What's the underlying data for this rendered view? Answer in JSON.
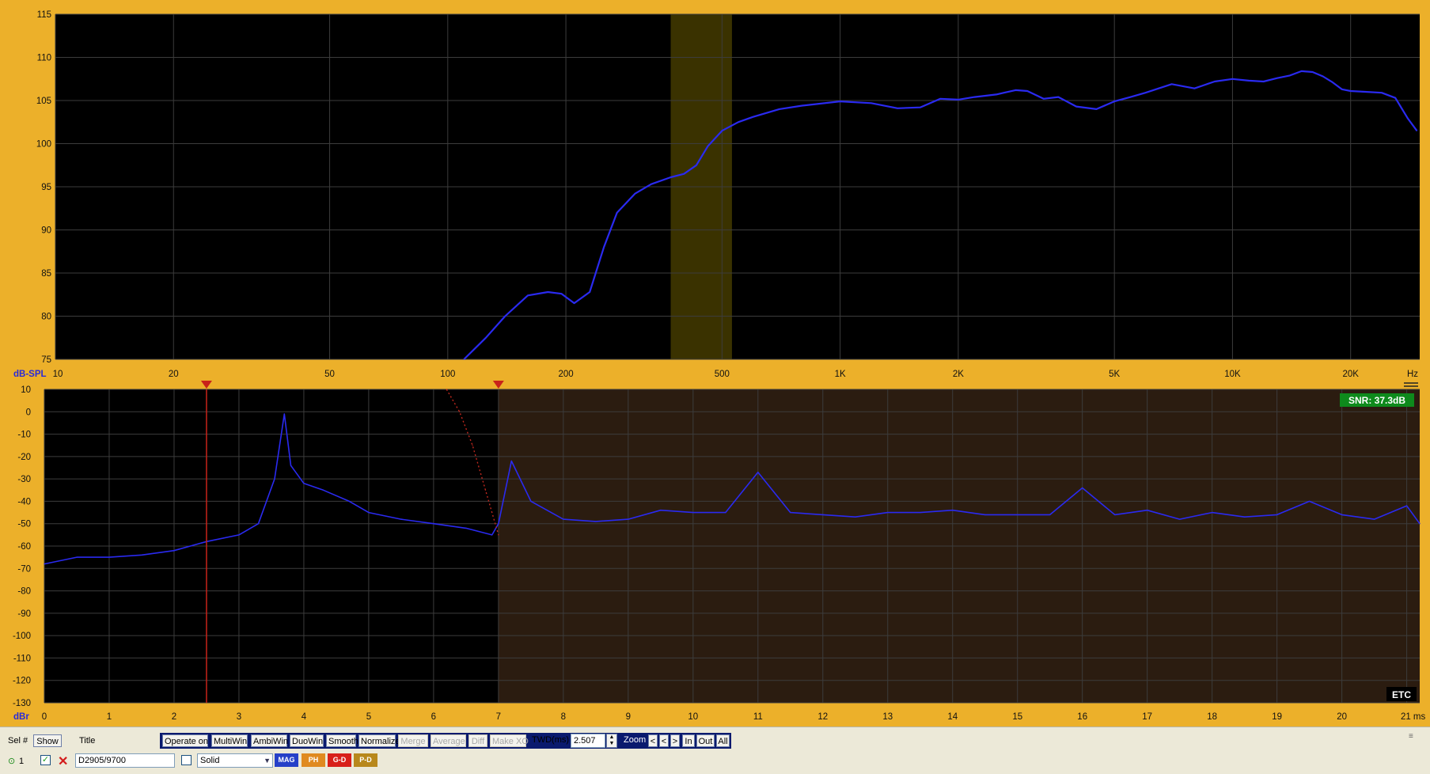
{
  "chart_data": [
    {
      "type": "line",
      "title": "",
      "xscale": "log",
      "xlim": [
        10,
        30000
      ],
      "ylim": [
        75,
        115
      ],
      "ylabel": "dB-SPL",
      "xunit": "Hz",
      "x_ticks": [
        10,
        20,
        50,
        100,
        200,
        500,
        1000,
        2000,
        5000,
        10000,
        20000
      ],
      "x_tick_labels": [
        "10",
        "20",
        "50",
        "100",
        "200",
        "500",
        "1K",
        "2K",
        "5K",
        "10K",
        "20K"
      ],
      "y_ticks": [
        75,
        80,
        85,
        90,
        95,
        100,
        105,
        110,
        115
      ],
      "y_tick_labels": [
        "75",
        "80",
        "85",
        "90",
        "95",
        "100",
        "105",
        "110",
        "115"
      ],
      "grid": true,
      "highlight_band_hz": [
        370,
        530
      ],
      "series": [
        {
          "color": "#2a2af0",
          "x": [
            110,
            125,
            140,
            160,
            180,
            195,
            210,
            230,
            250,
            270,
            300,
            330,
            370,
            400,
            430,
            460,
            500,
            550,
            600,
            700,
            800,
            1000,
            1200,
            1400,
            1600,
            1800,
            2000,
            2200,
            2500,
            2800,
            3000,
            3300,
            3600,
            4000,
            4500,
            5000,
            5500,
            6000,
            7000,
            8000,
            9000,
            10000,
            11000,
            12000,
            13000,
            14000,
            15000,
            16000,
            17000,
            18000,
            19000,
            20000,
            22000,
            24000,
            26000,
            28000,
            29500
          ],
          "y": [
            75,
            77.5,
            80,
            82.4,
            82.8,
            82.6,
            81.5,
            82.8,
            88,
            92,
            94.2,
            95.3,
            96.1,
            96.5,
            97.5,
            99.7,
            101.5,
            102.5,
            103.1,
            104,
            104.4,
            104.9,
            104.7,
            104.1,
            104.2,
            105.2,
            105.1,
            105.4,
            105.7,
            106.2,
            106.1,
            105.2,
            105.4,
            104.3,
            104,
            104.9,
            105.4,
            105.9,
            106.9,
            106.4,
            107.2,
            107.5,
            107.3,
            107.2,
            107.6,
            107.9,
            108.4,
            108.3,
            107.8,
            107.1,
            106.3,
            106.1,
            106,
            105.9,
            105.3,
            102.9,
            101.5
          ]
        }
      ]
    },
    {
      "type": "line",
      "title": "",
      "xlim": [
        0,
        21.2
      ],
      "ylim": [
        -130,
        10
      ],
      "ylabel": "dBr",
      "xunit": "ms",
      "x_ticks": [
        0,
        1,
        2,
        3,
        4,
        5,
        6,
        7,
        8,
        9,
        10,
        11,
        12,
        13,
        14,
        15,
        16,
        17,
        18,
        19,
        20,
        21
      ],
      "x_tick_labels": [
        "0",
        "1",
        "2",
        "3",
        "4",
        "5",
        "6",
        "7",
        "8",
        "9",
        "10",
        "11",
        "12",
        "13",
        "14",
        "15",
        "16",
        "17",
        "18",
        "19",
        "20",
        "21 ms"
      ],
      "y_ticks": [
        10,
        0,
        -10,
        -20,
        -30,
        -40,
        -50,
        -60,
        -70,
        -80,
        -90,
        -100,
        -110,
        -120,
        -130
      ],
      "y_tick_labels": [
        "10",
        "0",
        "-10",
        "-20",
        "-30",
        "-40",
        "-50",
        "-60",
        "-70",
        "-80",
        "-90",
        "-100",
        "-110",
        "-120",
        "-130"
      ],
      "grid": true,
      "window_markers_ms": [
        2.5,
        7.0
      ],
      "shaded_region_ms": [
        7.0,
        21.2
      ],
      "snr_badge": "SNR: 37.3dB",
      "corner_label": "ETC",
      "series": [
        {
          "color": "#2a2af0",
          "x": [
            0,
            0.5,
            1.0,
            1.5,
            2.0,
            2.5,
            3.0,
            3.3,
            3.55,
            3.7,
            3.8,
            4.0,
            4.3,
            4.7,
            5.0,
            5.5,
            6.0,
            6.5,
            6.9,
            7.0,
            7.2,
            7.5,
            8.0,
            8.5,
            9.0,
            9.5,
            10.0,
            10.5,
            11.0,
            11.5,
            12.0,
            12.5,
            13.0,
            13.5,
            14.0,
            14.5,
            15.0,
            15.5,
            16.0,
            16.5,
            17.0,
            17.5,
            18.0,
            18.5,
            19.0,
            19.5,
            20.0,
            20.5,
            21.0,
            21.2
          ],
          "y": [
            -68,
            -65,
            -65,
            -64,
            -62,
            -58,
            -55,
            -50,
            -30,
            -1,
            -24,
            -32,
            -35,
            -40,
            -45,
            -48,
            -50,
            -52,
            -55,
            -50,
            -22,
            -40,
            -48,
            -49,
            -48,
            -44,
            -45,
            -45,
            -27,
            -45,
            -46,
            -47,
            -45,
            -45,
            -44,
            -46,
            -46,
            -46,
            -34,
            -46,
            -44,
            -48,
            -45,
            -47,
            -46,
            -40,
            -46,
            -48,
            -42,
            -50
          ]
        },
        {
          "name": "",
          "color": "#c0281e",
          "style": "dotted",
          "x": [
            6.2,
            6.4,
            6.6,
            6.8,
            7.0
          ],
          "y": [
            10,
            0,
            -15,
            -35,
            -55
          ]
        }
      ]
    }
  ],
  "controls": {
    "sel_label": "Sel #",
    "show_button": "Show",
    "title_label": "Title",
    "operate_on": "Operate on",
    "multiwin": "MultiWin",
    "ambiwin": "AmbiWin",
    "duowin": "DuoWin",
    "smooth": "Smooth",
    "normalize": "Normalize",
    "merge": "Merge",
    "average": "Average",
    "diff": "Diff",
    "make_xo": "Make XO",
    "twd_label": "TWD(ms)",
    "twd_value": "2.507",
    "zoom_label": "Zoom",
    "zoom_left": "<",
    "zoom_left2": "<",
    "zoom_right": ">",
    "zoom_in": "In",
    "zoom_out": "Out",
    "zoom_all": "All",
    "row_number": "1",
    "row_title": "D2905/9700",
    "line_style": "Solid",
    "mag": "MAG",
    "ph": "PH",
    "gd": "G-D",
    "pd": "P-D"
  },
  "colors": {
    "frame": "#ecb02a",
    "plot_bg": "#000000",
    "grid": "#3c3c3c",
    "curve": "#2a2af0",
    "band": "#3a3200",
    "tail_shade": "#2b1c10",
    "marker": "#c8231a"
  }
}
